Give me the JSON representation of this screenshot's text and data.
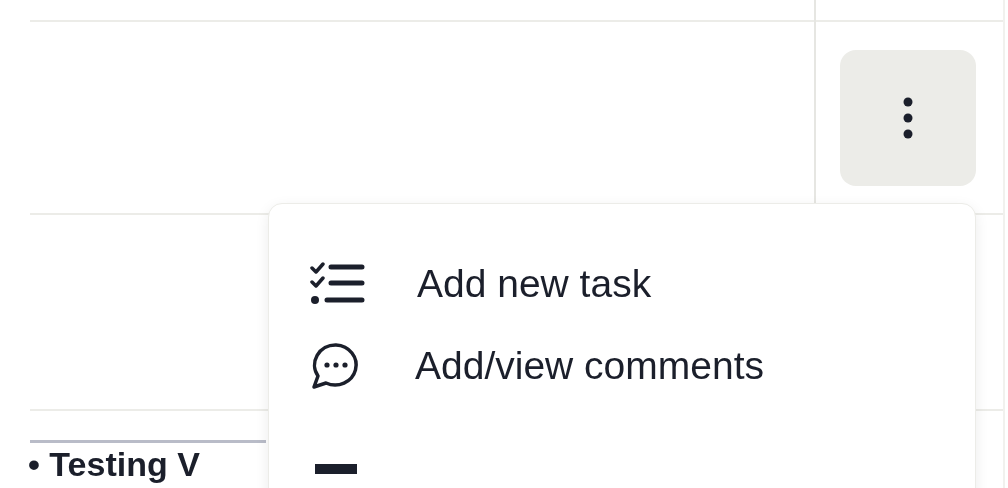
{
  "menu": {
    "items": [
      {
        "kind": "tasks",
        "label": "Add new task"
      },
      {
        "kind": "comments",
        "label": "Add/view comments"
      },
      {
        "kind": "table"
      }
    ]
  },
  "row_label": "• Testing V"
}
